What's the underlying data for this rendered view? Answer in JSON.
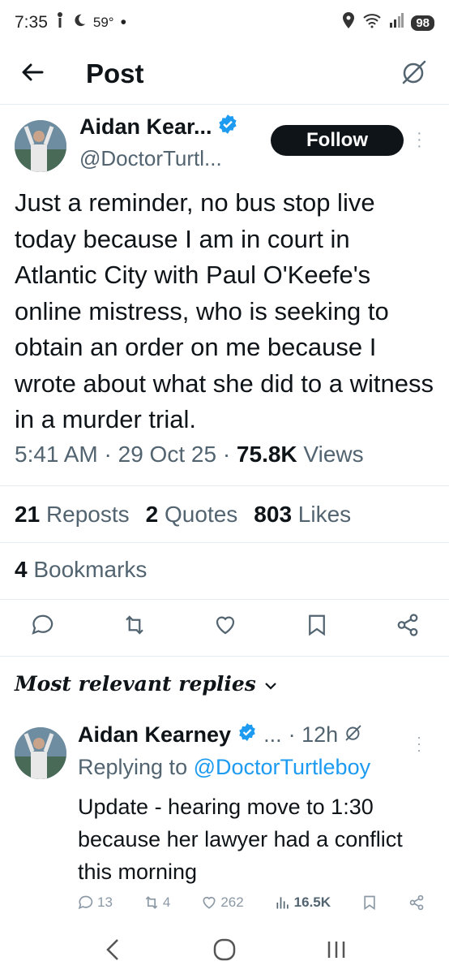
{
  "status_bar": {
    "time": "7:35",
    "temperature": "59°",
    "battery": "98"
  },
  "header": {
    "title": "Post"
  },
  "post": {
    "author_name": "Aidan Kear...",
    "author_handle": "@DoctorTurtl...",
    "follow_label": "Follow",
    "text": "Just a reminder, no bus stop live today because I am in court in Atlantic City with Paul O'Keefe's online mistress, who is seeking to obtain an order on me because I wrote about what she did to a witness in a murder trial.",
    "time": "5:41 AM",
    "date": "29 Oct 25",
    "views_count": "75.8K",
    "views_label": "Views",
    "reposts_count": "21",
    "reposts_label": "Reposts",
    "quotes_count": "2",
    "quotes_label": "Quotes",
    "likes_count": "803",
    "likes_label": "Likes",
    "bookmarks_count": "4",
    "bookmarks_label": "Bookmarks"
  },
  "replies_section": {
    "label": "Most relevant replies"
  },
  "reply": {
    "author_name": "Aidan Kearney",
    "ellipsis": "...",
    "age": "· 12h",
    "replying_prefix": "Replying to",
    "replying_handle": "@DoctorTurtleboy",
    "text": "Update - hearing move to 1:30 because her lawyer had a conflict this morning",
    "replies": "13",
    "reposts": "4",
    "likes": "262",
    "views": "16.5K"
  },
  "colors": {
    "accent": "#1d9bf0",
    "text_primary": "#0f1419",
    "text_secondary": "#536471"
  }
}
